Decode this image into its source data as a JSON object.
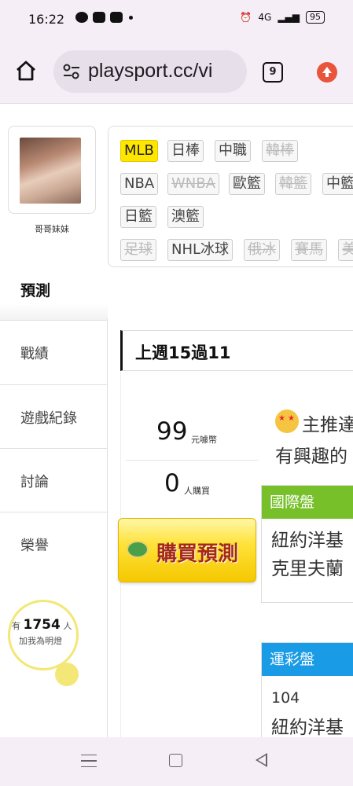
{
  "status_bar": {
    "time": "16:22",
    "battery": "95",
    "signal": "4G"
  },
  "browser": {
    "url": "playsport.cc/vi",
    "tab_count": "9"
  },
  "profile": {
    "name": "哥哥妹妹"
  },
  "sidebar": {
    "active": "預測",
    "items": [
      {
        "label": "戰績"
      },
      {
        "label": "遊戲紀錄"
      },
      {
        "label": "討論"
      },
      {
        "label": "榮譽"
      }
    ],
    "bulb": {
      "prefix": "有",
      "count": "1754",
      "suffix": "人",
      "line2": "加我為明燈"
    }
  },
  "sports_tags": {
    "row1": [
      "MLB",
      "日棒",
      "中職",
      "韓棒"
    ],
    "row2": [
      "NBA",
      "WNBA",
      "歐籃",
      "韓籃",
      "中籃"
    ],
    "row3": [
      "日籃",
      "澳籃"
    ],
    "row4": [
      "足球",
      "NHL冰球",
      "俄冰",
      "賽馬",
      "美"
    ]
  },
  "record": {
    "title": "上週15過11"
  },
  "price": {
    "amount": "99",
    "unit": "元噱幣",
    "buyers": "0",
    "buyers_unit": "人購買",
    "buy_label": "購買預測"
  },
  "content": {
    "main_pick": "主推達",
    "interest": "有興趣的",
    "intl_section": {
      "title": "國際盤",
      "lines": [
        "紐約洋基",
        "克里夫蘭"
      ]
    },
    "lottery_section": {
      "title": "運彩盤",
      "number": "104",
      "lines": [
        "紐約洋基"
      ]
    }
  },
  "colors": {
    "accent_yellow": "#ffe600",
    "intl_green": "#77c02a",
    "lottery_blue": "#1a9be6"
  }
}
